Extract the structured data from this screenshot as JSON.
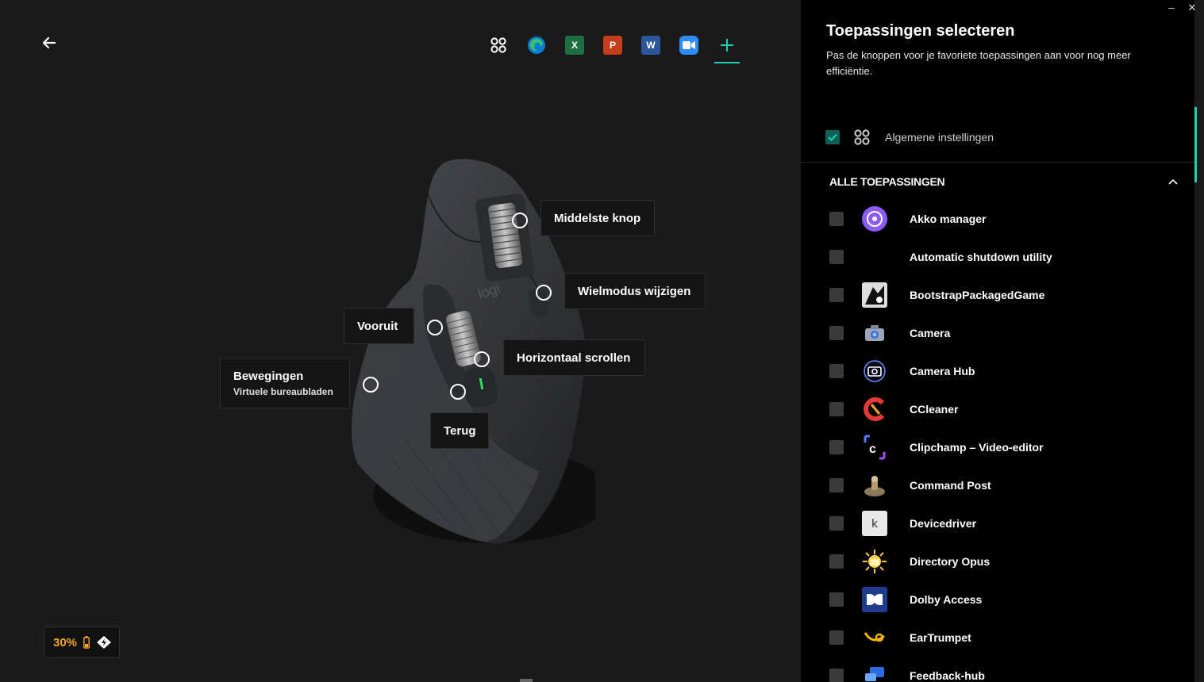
{
  "window": {
    "minimize_glyph": "–",
    "close_glyph": "✕"
  },
  "app_bar": {
    "tabs": [
      {
        "name": "general-settings",
        "icon": "grid-icon"
      },
      {
        "name": "edge",
        "icon": "edge-icon"
      },
      {
        "name": "excel",
        "icon": "excel-icon",
        "letter": "X",
        "color": "#1d6f42"
      },
      {
        "name": "powerpoint",
        "icon": "powerpoint-icon",
        "letter": "P",
        "color": "#c43e1c"
      },
      {
        "name": "word",
        "icon": "word-icon",
        "letter": "W",
        "color": "#2b579a"
      },
      {
        "name": "zoom",
        "icon": "zoom-icon",
        "color": "#2d8cff"
      },
      {
        "name": "add",
        "icon": "plus-icon",
        "active": true
      }
    ]
  },
  "callouts": {
    "middle": "Middelste knop",
    "wheel_mode": "Wielmodus wijzigen",
    "forward": "Vooruit",
    "horizontal": "Horizontaal scrollen",
    "gestures_title": "Bewegingen",
    "gestures_sub": "Virtuele bureaubladen",
    "back": "Terug"
  },
  "battery": {
    "percent": "30%",
    "color": "#f5a623"
  },
  "panel": {
    "title": "Toepassingen selecteren",
    "subtitle": "Pas de knoppen voor je favoriete toepassingen aan voor nog meer efficiëntie.",
    "general_label": "Algemene instellingen",
    "all_apps_title": "ALLE TOEPASSINGEN",
    "apps": [
      {
        "name": "Akko manager",
        "icon": "akko-icon"
      },
      {
        "name": "Automatic shutdown utility",
        "icon": "blank-icon"
      },
      {
        "name": "BootstrapPackagedGame",
        "icon": "bootstrap-icon"
      },
      {
        "name": "Camera",
        "icon": "camera-icon"
      },
      {
        "name": "Camera Hub",
        "icon": "camera-hub-icon"
      },
      {
        "name": "CCleaner",
        "icon": "ccleaner-icon"
      },
      {
        "name": "Clipchamp – Video-editor",
        "icon": "clipchamp-icon"
      },
      {
        "name": "Command Post",
        "icon": "command-post-icon"
      },
      {
        "name": "Devicedriver",
        "icon": "devicedriver-icon"
      },
      {
        "name": "Directory Opus",
        "icon": "directory-opus-icon"
      },
      {
        "name": "Dolby Access",
        "icon": "dolby-icon"
      },
      {
        "name": "EarTrumpet",
        "icon": "eartrumpet-icon"
      },
      {
        "name": "Feedback-hub",
        "icon": "feedback-hub-icon"
      }
    ]
  }
}
